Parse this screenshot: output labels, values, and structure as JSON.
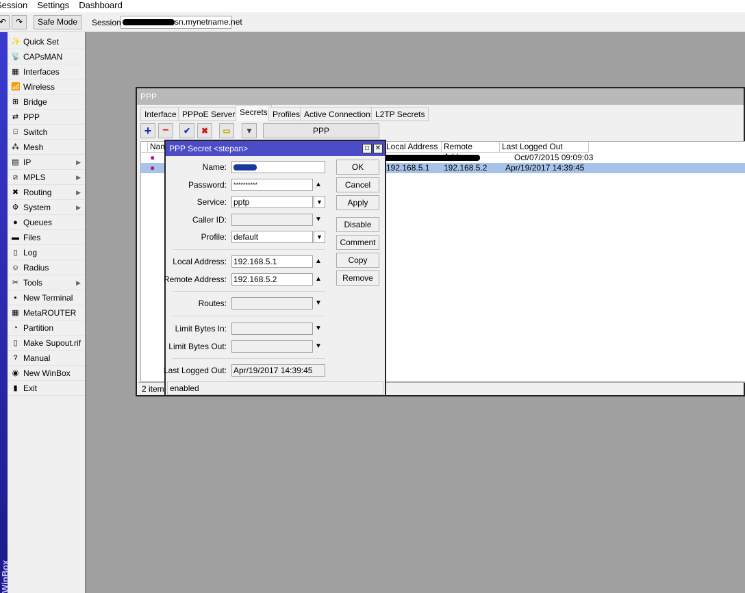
{
  "menubar": {
    "items": [
      "Session",
      "Settings",
      "Dashboard"
    ]
  },
  "toolbar": {
    "undo": "↶",
    "redo": "↷",
    "safe_mode": "Safe Mode",
    "session_label": "Session:",
    "session_value": "sn.mynetname.net"
  },
  "sidebar": {
    "brand": "WinBox",
    "items": [
      {
        "label": "Quick Set",
        "icon": "✨",
        "sub": false
      },
      {
        "label": "CAPsMAN",
        "icon": "📡",
        "sub": false
      },
      {
        "label": "Interfaces",
        "icon": "▦",
        "sub": false
      },
      {
        "label": "Wireless",
        "icon": "📶",
        "sub": false
      },
      {
        "label": "Bridge",
        "icon": "⊞",
        "sub": false
      },
      {
        "label": "PPP",
        "icon": "⇄",
        "sub": false
      },
      {
        "label": "Switch",
        "icon": "⌸",
        "sub": false
      },
      {
        "label": "Mesh",
        "icon": "⁂",
        "sub": false
      },
      {
        "label": "IP",
        "icon": "▤",
        "sub": true
      },
      {
        "label": "MPLS",
        "icon": "⧄",
        "sub": true
      },
      {
        "label": "Routing",
        "icon": "✖",
        "sub": true
      },
      {
        "label": "System",
        "icon": "⚙",
        "sub": true
      },
      {
        "label": "Queues",
        "icon": "●",
        "sub": false
      },
      {
        "label": "Files",
        "icon": "▬",
        "sub": false
      },
      {
        "label": "Log",
        "icon": "▯",
        "sub": false
      },
      {
        "label": "Radius",
        "icon": "☺",
        "sub": false
      },
      {
        "label": "Tools",
        "icon": "✂",
        "sub": true
      },
      {
        "label": "New Terminal",
        "icon": "▪",
        "sub": false
      },
      {
        "label": "MetaROUTER",
        "icon": "▦",
        "sub": false
      },
      {
        "label": "Partition",
        "icon": "◔",
        "sub": false
      },
      {
        "label": "Make Supout.rif",
        "icon": "▯",
        "sub": false
      },
      {
        "label": "Manual",
        "icon": "?",
        "sub": false
      },
      {
        "label": "New WinBox",
        "icon": "◉",
        "sub": false
      },
      {
        "label": "Exit",
        "icon": "▮",
        "sub": false
      }
    ]
  },
  "ppp": {
    "title": "PPP",
    "tabs": [
      {
        "label": "Interface"
      },
      {
        "label": "PPPoE Servers"
      },
      {
        "label": "Secrets",
        "active": true
      },
      {
        "label": "Profiles"
      },
      {
        "label": "Active Connections"
      },
      {
        "label": "L2TP Secrets"
      }
    ],
    "toolbar": {
      "add": "+",
      "remove": "−",
      "enable": "✔",
      "disable": "✖",
      "comment": "▭",
      "filter": "▼",
      "auth": "PPP Authentication&Accounting"
    },
    "columns": [
      "Name",
      "Local Address",
      "Remote Address",
      "Last Logged Out"
    ],
    "rows": [
      {
        "local": "",
        "remote": "",
        "last": "Oct/07/2015 09:09:03",
        "selected": false
      },
      {
        "local": "192.168.5.1",
        "remote": "192.168.5.2",
        "last": "Apr/19/2017 14:39:45",
        "selected": true
      }
    ],
    "status": "2 items"
  },
  "dialog": {
    "title": "PPP Secret <stepan>",
    "fields": {
      "name": "Name:",
      "password": "Password:",
      "password_value": "**********",
      "service": "Service:",
      "service_value": "pptp",
      "caller_id": "Caller ID:",
      "profile": "Profile:",
      "profile_value": "default",
      "local": "Local Address:",
      "local_value": "192.168.5.1",
      "remote": "Remote Address:",
      "remote_value": "192.168.5.2",
      "routes": "Routes:",
      "limit_in": "Limit Bytes In:",
      "limit_out": "Limit Bytes Out:",
      "last": "Last Logged Out:",
      "last_value": "Apr/19/2017 14:39:45"
    },
    "buttons": {
      "ok": "OK",
      "cancel": "Cancel",
      "apply": "Apply",
      "disable": "Disable",
      "comment": "Comment",
      "copy": "Copy",
      "remove": "Remove"
    },
    "status": "enabled"
  },
  "colors": {
    "dialog_title": "#4c4cc8",
    "selection": "#a7c3e9",
    "workspace": "#a0a0a0"
  }
}
